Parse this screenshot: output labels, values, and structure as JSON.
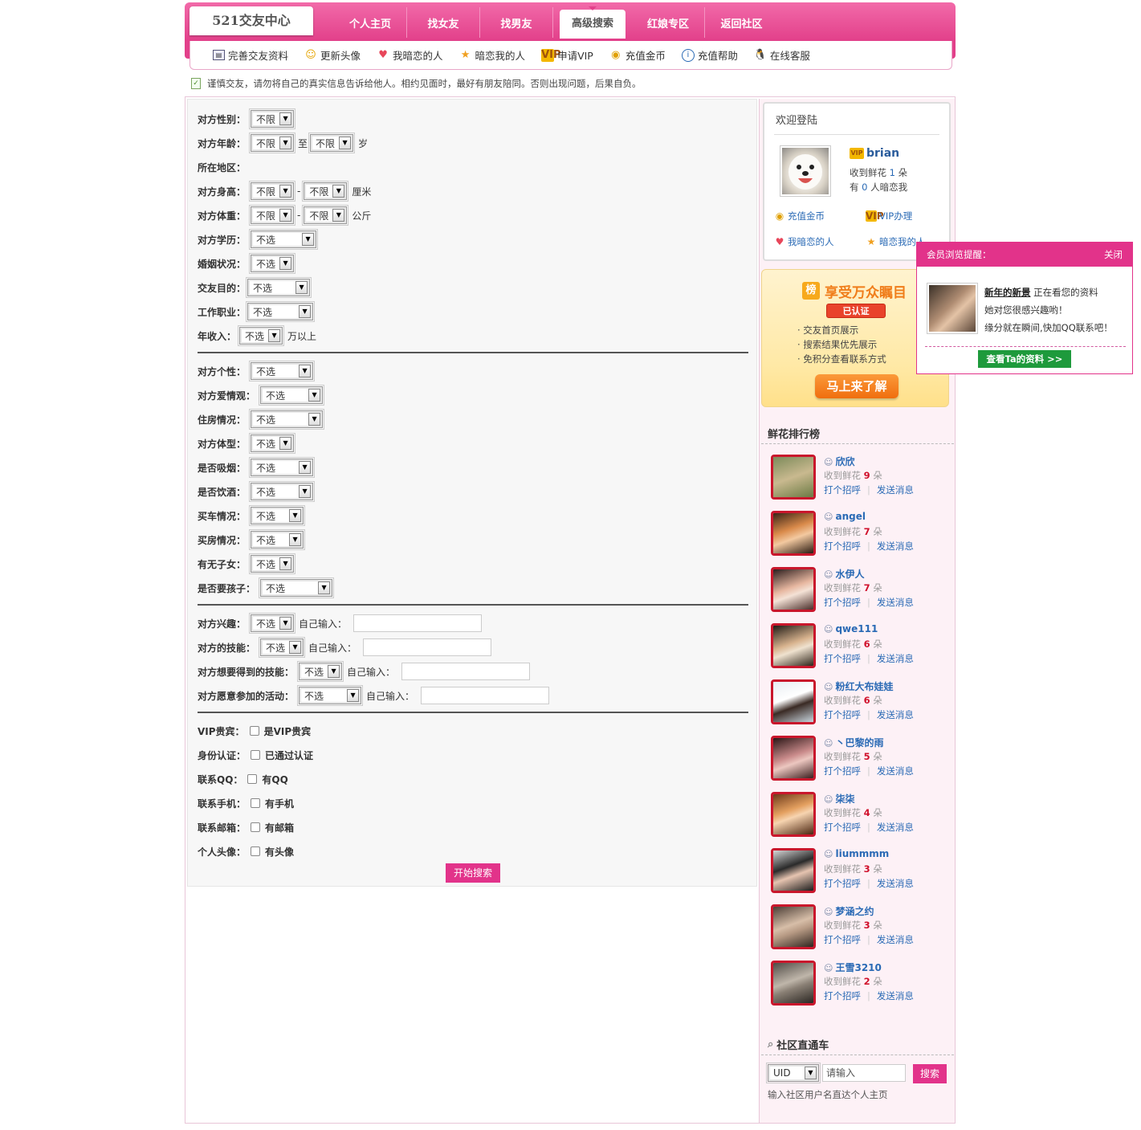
{
  "header": {
    "logo": "521交友中心",
    "nav": [
      {
        "label": "个人主页"
      },
      {
        "label": "找女友"
      },
      {
        "label": "找男友"
      },
      {
        "label": "高级搜索"
      },
      {
        "label": "红娘专区"
      },
      {
        "label": "返回社区"
      }
    ],
    "active_nav": "高级搜索"
  },
  "subnav": [
    {
      "label": "完善交友资料",
      "icon": "profile-card-icon"
    },
    {
      "label": "更新头像",
      "icon": "smiley-icon"
    },
    {
      "label": "我暗恋的人",
      "icon": "heart-icon"
    },
    {
      "label": "暗恋我的人",
      "icon": "star-icon"
    },
    {
      "label": "申请VIP",
      "icon": "vip-icon"
    },
    {
      "label": "充值金币",
      "icon": "coins-icon"
    },
    {
      "label": "充值帮助",
      "icon": "info-icon"
    },
    {
      "label": "在线客服",
      "icon": "qq-penguin-icon"
    }
  ],
  "notice": "谨慎交友，请勿将自己的真实信息告诉给他人。相约见面时，最好有朋友陪同。否则出现问题，后果自负。",
  "form": {
    "gender": {
      "label": "对方性别：",
      "value": "不限"
    },
    "age": {
      "label": "对方年龄：",
      "from": "不限",
      "to_text": "至",
      "to": "不限",
      "unit": "岁"
    },
    "region": {
      "label": "所在地区："
    },
    "height": {
      "label": "对方身高：",
      "from": "不限",
      "sep": "-",
      "to": "不限",
      "unit": "厘米"
    },
    "weight": {
      "label": "对方体重：",
      "from": "不限",
      "sep": "-",
      "to": "不限",
      "unit": "公斤"
    },
    "education": {
      "label": "对方学历：",
      "value": "不选"
    },
    "marriage": {
      "label": "婚姻状况：",
      "value": "不选"
    },
    "purpose": {
      "label": "交友目的：",
      "value": "不选"
    },
    "job": {
      "label": "工作职业：",
      "value": "不选"
    },
    "income": {
      "label": "年收入：",
      "value": "不选",
      "unit": "万以上"
    },
    "personality": {
      "label": "对方个性：",
      "value": "不选"
    },
    "love_view": {
      "label": "对方爱情观：",
      "value": "不选"
    },
    "housing": {
      "label": "住房情况：",
      "value": "不选"
    },
    "body": {
      "label": "对方体型：",
      "value": "不选"
    },
    "smoke": {
      "label": "是否吸烟：",
      "value": "不选"
    },
    "drink": {
      "label": "是否饮酒：",
      "value": "不选"
    },
    "car": {
      "label": "买车情况：",
      "value": "不选"
    },
    "house_buy": {
      "label": "买房情况：",
      "value": "不选"
    },
    "children": {
      "label": "有无子女：",
      "value": "不选"
    },
    "want_child": {
      "label": "是否要孩子：",
      "value": "不选"
    },
    "custom_input_label": "自己输入：",
    "interest": {
      "label": "对方兴趣：",
      "value": "不选"
    },
    "skills": {
      "label": "对方的技能：",
      "value": "不选"
    },
    "want_skills": {
      "label": "对方想要得到的技能：",
      "value": "不选"
    },
    "activities": {
      "label": "对方愿意参加的活动：",
      "value": "不选"
    },
    "vip": {
      "label": "VIP贵宾：",
      "option": "是VIP贵宾"
    },
    "cert": {
      "label": "身份认证：",
      "option": "已通过认证"
    },
    "qq": {
      "label": "联系QQ：",
      "option": "有QQ"
    },
    "phone": {
      "label": "联系手机：",
      "option": "有手机"
    },
    "email": {
      "label": "联系邮箱：",
      "option": "有邮箱"
    },
    "avatar": {
      "label": "个人头像：",
      "option": "有头像"
    },
    "submit": "开始搜索"
  },
  "login": {
    "title": "欢迎登陆",
    "username": "brian",
    "flowers_text": "收到鲜花",
    "flowers": "1",
    "flowers_unit": "朵",
    "crush_pre": "有",
    "crush_count": "0",
    "crush_post": "人暗恋我",
    "links": [
      "充值金币",
      "VIP办理",
      "我暗恋的人",
      "暗恋我的人"
    ]
  },
  "banner": {
    "badge": "榜",
    "title": "享受万众瞩目",
    "cert": "已认证",
    "items": [
      "· 交友首页展示",
      "· 搜索结果优先展示",
      "· 免积分查看联系方式"
    ],
    "button": "马上来了解"
  },
  "ranking": {
    "title": "鲜花排行榜",
    "flower_label": "收到鲜花",
    "unit": "朵",
    "action1": "打个招呼",
    "action2": "发送消息",
    "items": [
      {
        "name": "欣欣",
        "count": "9"
      },
      {
        "name": "angel",
        "count": "7"
      },
      {
        "name": "水伊人",
        "count": "7"
      },
      {
        "name": "qwe111",
        "count": "6"
      },
      {
        "name": "粉红大布娃娃",
        "count": "6"
      },
      {
        "name": "丶巴黎的雨",
        "count": "5"
      },
      {
        "name": "柒柒",
        "count": "4"
      },
      {
        "name": "liummmm",
        "count": "3"
      },
      {
        "name": "梦涵之约",
        "count": "3"
      },
      {
        "name": "王雪3210",
        "count": "2"
      }
    ]
  },
  "community": {
    "title": "社区直通车",
    "select": "UID",
    "placeholder": "请输入",
    "button": "搜索",
    "tip": "输入社区用户名直达个人主页"
  },
  "popup": {
    "title": "会员浏览提醒：",
    "close": "关闭",
    "name": "新年的新景",
    "line1_rest": "正在看您的资料",
    "line2": "她对您很感兴趣哟！",
    "line3": "缘分就在瞬间,快加QQ联系吧！",
    "button": "查看Ta的资料 >>"
  }
}
